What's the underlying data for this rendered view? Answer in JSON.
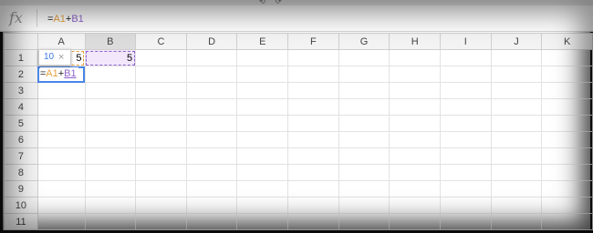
{
  "formula_bar": {
    "icon": "fx-icon",
    "fx_label": "fx",
    "formula_prefix": "=",
    "ref_a": "A1",
    "operator": "+",
    "ref_b": "B1"
  },
  "columns": [
    "A",
    "B",
    "C",
    "D",
    "E",
    "F",
    "G",
    "H",
    "I",
    "J",
    "K"
  ],
  "rows": [
    "1",
    "2",
    "3",
    "4",
    "5",
    "6",
    "7",
    "8",
    "9",
    "10",
    "11"
  ],
  "cells": {
    "A1": "5",
    "B1": "5"
  },
  "editing_cell": {
    "prefix": "=",
    "ref_a": "A1",
    "operator": "+",
    "ref_b": "B1"
  },
  "tooltip": {
    "value": "10",
    "close_icon": "close-icon",
    "close_glyph": "×"
  },
  "colors": {
    "ref_a": "#e8a13a",
    "ref_b": "#8e63ce",
    "selection": "#4a86e8",
    "tooltip_value": "#3b78e7"
  }
}
